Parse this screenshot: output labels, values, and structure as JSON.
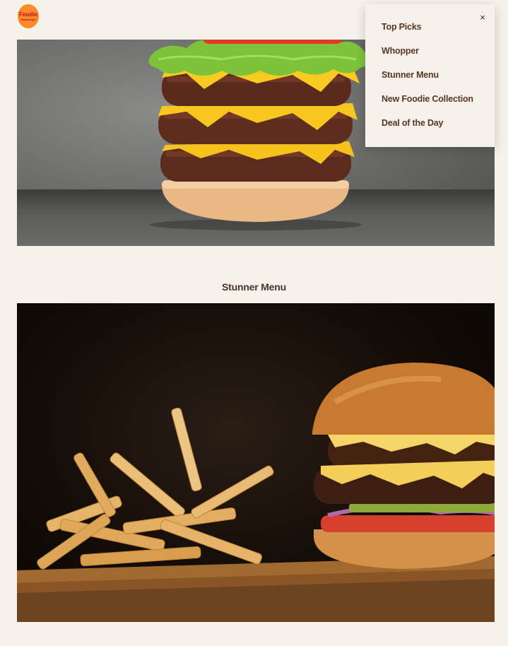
{
  "brand": {
    "logo_line1": "Foodie",
    "logo_line2": "Hamburger"
  },
  "menu": {
    "close_icon": "close-icon",
    "close_glyph": "×",
    "items": [
      {
        "label": "Top Picks"
      },
      {
        "label": "Whopper"
      },
      {
        "label": "Stunner Menu"
      },
      {
        "label": "New Foodie Collection"
      },
      {
        "label": "Deal of the Day"
      }
    ]
  },
  "section": {
    "title": "Stunner Menu"
  },
  "colors": {
    "background": "#f6f1ea",
    "logo": "#ff8a2a",
    "menu_text": "#5a3723"
  }
}
